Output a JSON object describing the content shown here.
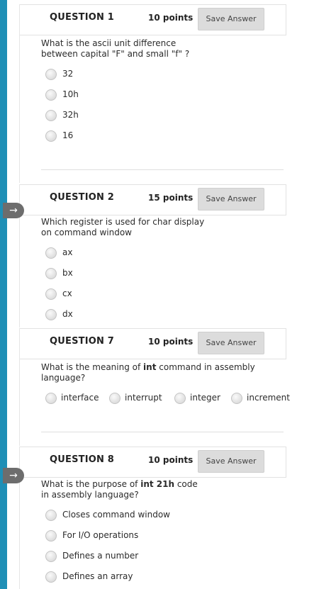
{
  "questions": [
    {
      "title": "QUESTION 1",
      "points": "10 points",
      "save_label": "Save Answer",
      "text": "What is the ascii unit difference between capital \"F\" and small \"f\" ?",
      "text_lines": [
        "What is the ascii unit difference",
        "between capital \"F\" and small \"f\" ?"
      ],
      "options": [
        "32",
        "10h",
        "32h",
        "16"
      ]
    },
    {
      "title": "QUESTION 2",
      "points": "15 points",
      "save_label": "Save Answer",
      "text_lines": [
        "Which register is used for char display",
        "on command window"
      ],
      "options": [
        "ax",
        "bx",
        "cx",
        "dx"
      ]
    },
    {
      "title": "QUESTION 7",
      "points": "10 points",
      "save_label": "Save Answer",
      "text_line1_pre": "What is the meaning of ",
      "text_line1_bold": "int",
      "text_line1_post": " command in assembly",
      "text_line2": "language?",
      "options": [
        "interface",
        "interrupt",
        "integer",
        "increment"
      ]
    },
    {
      "title": "QUESTION 8",
      "points": "10 points",
      "save_label": "Save Answer",
      "text_line1_pre": "What is the purpose of ",
      "text_line1_bold": "int 21h",
      "text_line1_post": " code",
      "text_line2": "in assembly language?",
      "options": [
        "Closes command window",
        "For I/O operations",
        "Defines a number",
        "Defines an array"
      ]
    }
  ],
  "nav_arrow_icon": "→",
  "colors": {
    "accent_bar": "#1f8fb6",
    "save_button_bg": "#dcdcdc",
    "nav_arrow_bg": "#6d6d6d"
  }
}
